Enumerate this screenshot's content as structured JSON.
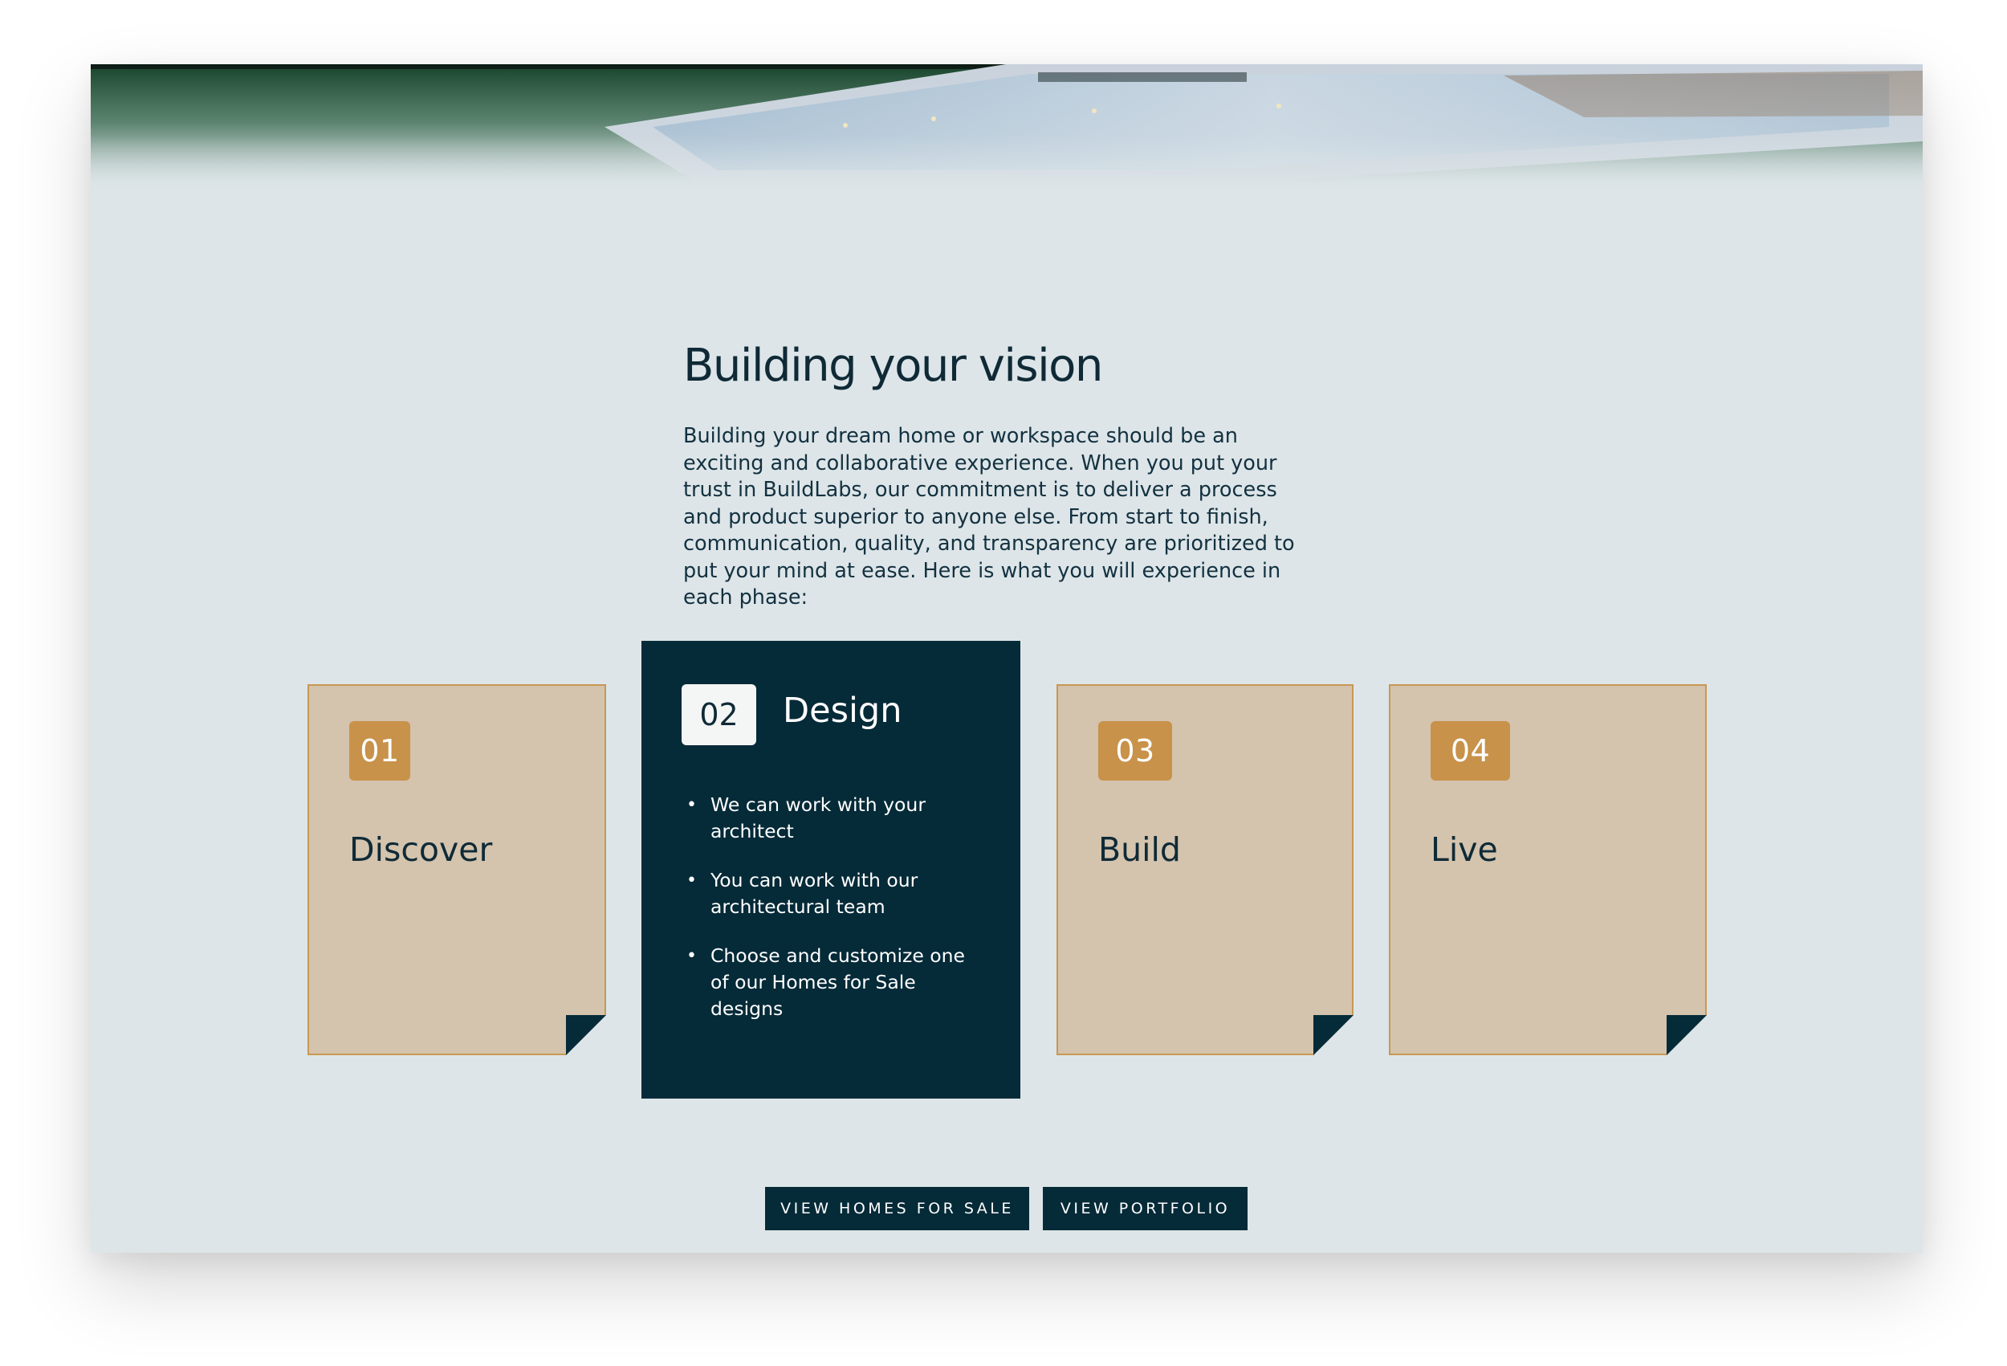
{
  "section": {
    "title": "Building your vision",
    "intro": "Building your dream home or workspace should be an exciting and collaborative experience. When you put your trust in BuildLabs, our commitment is to deliver a process and product superior to anyone else. From start to finish, communication, quality, and transparency are prioritized to put your mind at ease. Here is what you will experience in each phase:"
  },
  "phases": [
    {
      "number": "01",
      "title": "Discover"
    },
    {
      "number": "02",
      "title": "Design",
      "items": [
        "We can work with your architect",
        "You can work with our architectural team",
        "Choose and customize one of our Homes for Sale designs"
      ]
    },
    {
      "number": "03",
      "title": "Build"
    },
    {
      "number": "04",
      "title": "Live"
    }
  ],
  "buttons": {
    "homes": "VIEW HOMES FOR SALE",
    "portfolio": "VIEW PORTFOLIO"
  },
  "colors": {
    "background": "#dde5e8",
    "navy": "#052a38",
    "card": "#d4c3ad",
    "accent": "#c8924a"
  }
}
